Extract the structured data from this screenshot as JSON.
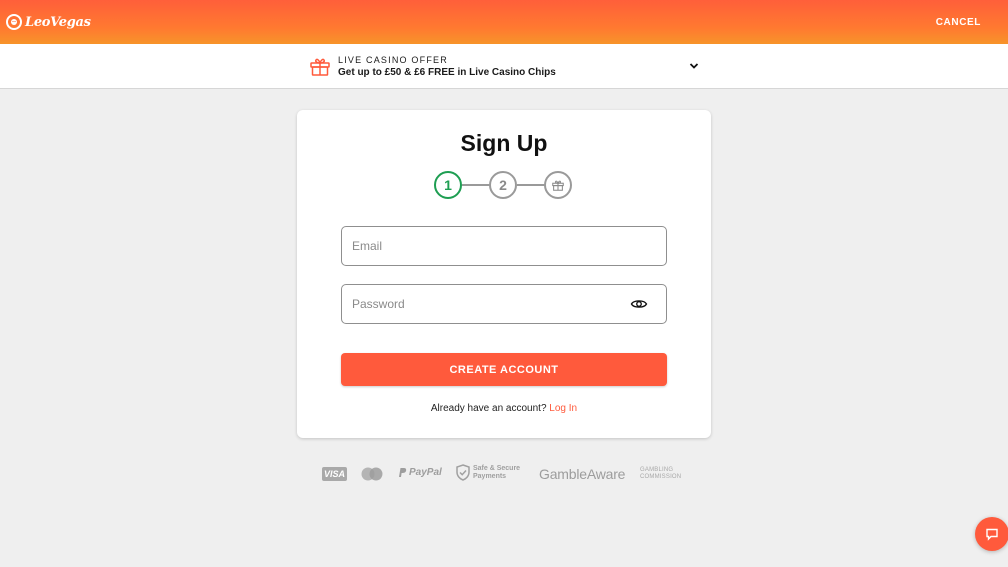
{
  "header": {
    "brand": "LeoVegas",
    "cancel_label": "CANCEL"
  },
  "offer": {
    "title": "LIVE CASINO OFFER",
    "description": "Get up to £50 & £6 FREE in Live Casino Chips",
    "icon": "gift-icon",
    "expand_icon": "chevron-down-icon"
  },
  "signup": {
    "title": "Sign Up",
    "steps": [
      {
        "label": "1",
        "state": "active"
      },
      {
        "label": "2",
        "state": "inactive"
      },
      {
        "label": "",
        "icon": "gift-icon",
        "state": "inactive"
      }
    ],
    "email": {
      "placeholder": "Email",
      "value": ""
    },
    "password": {
      "placeholder": "Password",
      "value": "",
      "toggle_icon": "eye-icon"
    },
    "create_button": "CREATE ACCOUNT",
    "login_prompt": "Already have an account?",
    "login_link": "Log In"
  },
  "footer": {
    "visa": "VISA",
    "mastercard_icon": "mastercard-icon",
    "paypal": "PayPal",
    "secure_line1": "Safe & Secure",
    "secure_line2": "Payments",
    "gambleaware": "GambleAware",
    "commission_line1": "GAMBLING",
    "commission_line2": "COMMISSION"
  },
  "chat": {
    "icon": "chat-icon"
  },
  "colors": {
    "brand_orange": "#ff5a3c",
    "step_active": "#1e9e52",
    "background": "#efefef"
  }
}
